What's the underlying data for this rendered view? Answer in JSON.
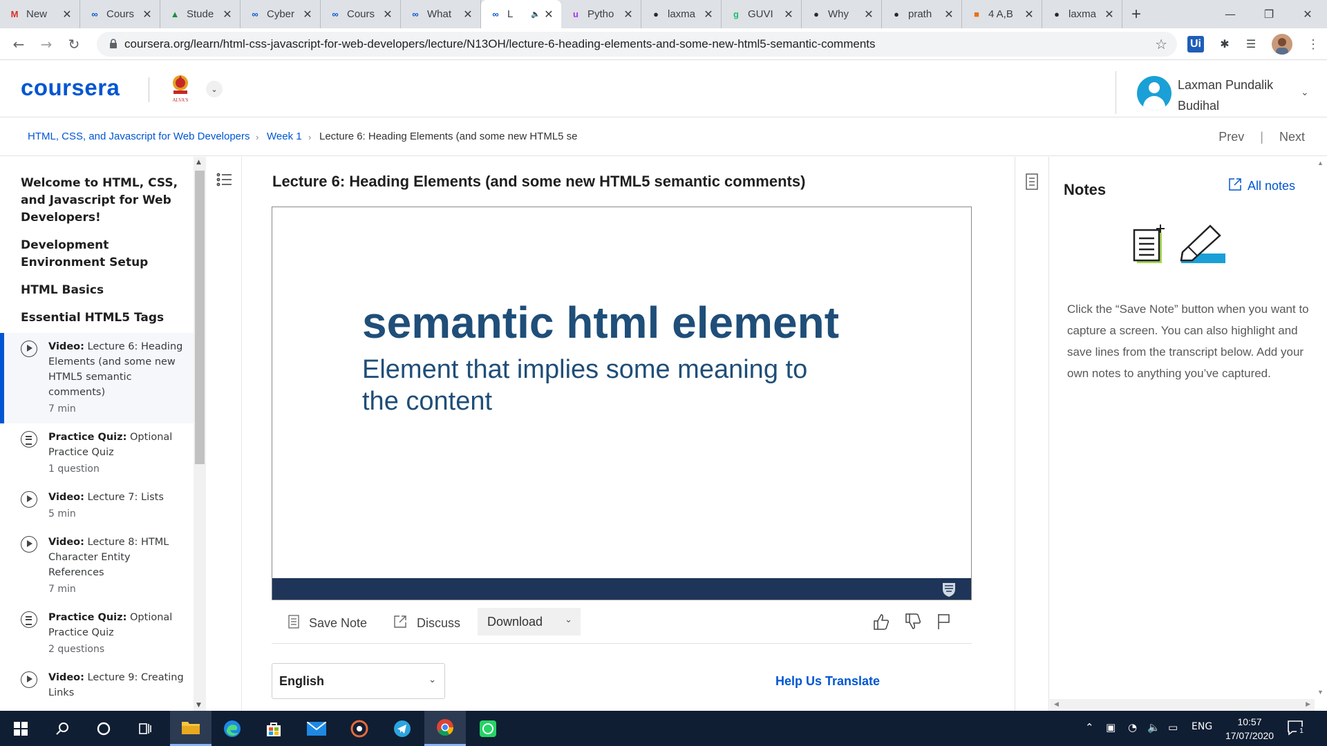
{
  "browser": {
    "tabs": [
      {
        "title": "New",
        "icon": "gmail-icon",
        "color": "#d93025",
        "glyph": "M"
      },
      {
        "title": "Cours",
        "icon": "coursera-icon",
        "color": "#0056d2",
        "glyph": "∞"
      },
      {
        "title": "Stude",
        "icon": "drive-icon",
        "color": "#1e8e3e",
        "glyph": "▲"
      },
      {
        "title": "Cyber",
        "icon": "coursera-icon",
        "color": "#0056d2",
        "glyph": "∞"
      },
      {
        "title": "Cours",
        "icon": "coursera-icon",
        "color": "#0056d2",
        "glyph": "∞"
      },
      {
        "title": "What",
        "icon": "coursera-icon",
        "color": "#0056d2",
        "glyph": "∞"
      },
      {
        "title": "L",
        "icon": "coursera-icon",
        "color": "#0056d2",
        "glyph": "∞",
        "active": true,
        "audio": "🔈"
      },
      {
        "title": "Pytho",
        "icon": "udemy-icon",
        "color": "#a435f0",
        "glyph": "u"
      },
      {
        "title": "laxma",
        "icon": "github-icon",
        "color": "#24292e",
        "glyph": "●"
      },
      {
        "title": "GUVI",
        "icon": "guvi-icon",
        "color": "#1dbf73",
        "glyph": "g"
      },
      {
        "title": "Why",
        "icon": "github-icon",
        "color": "#24292e",
        "glyph": "●"
      },
      {
        "title": "prath",
        "icon": "github-icon",
        "color": "#24292e",
        "glyph": "●"
      },
      {
        "title": "4 A,B",
        "icon": "orange-site-icon",
        "color": "#e8710a",
        "glyph": "■"
      },
      {
        "title": "laxma",
        "icon": "github-icon",
        "color": "#24292e",
        "glyph": "●"
      }
    ],
    "close_glyph": "✕",
    "new_tab_glyph": "+",
    "minimize_glyph": "—",
    "maximize_glyph": "❐",
    "close_window_glyph": "✕",
    "back_glyph": "←",
    "forward_glyph": "→",
    "reload_glyph": "↻",
    "url": "coursera.org/learn/html-css-javascript-for-web-developers/lecture/N13OH/lecture-6-heading-elements-and-some-new-html5-semantic-comments",
    "bookmark_glyph": "☆",
    "ext_uipath_label": "Ui",
    "ext_puzzle_glyph": "✱",
    "ext_media_glyph": "☰"
  },
  "header": {
    "logo_text": "coursera",
    "institution_logo_text": "ALVA'S",
    "user_name": "Laxman Pundalik Budihal",
    "caret": "⌄"
  },
  "breadcrumb": {
    "course": "HTML, CSS, and Javascript for Web Developers",
    "week": "Week 1",
    "current": "Lecture 6: Heading Elements (and some new HTML5 se",
    "separator": "›",
    "prev": "Prev",
    "next": "Next",
    "divider": "|"
  },
  "sidebar": {
    "sections": [
      "Welcome to HTML, CSS, and Javascript for Web Developers!",
      "Development Environment Setup",
      "HTML Basics",
      "Essential HTML5 Tags"
    ],
    "items": [
      {
        "kind": "Video:",
        "title": "Lecture 6: Heading Elements (and some new HTML5 semantic comments)",
        "meta": "7 min",
        "type": "video",
        "active": true
      },
      {
        "kind": "Practice Quiz:",
        "title": "Optional Practice Quiz",
        "meta": "1 question",
        "type": "quiz"
      },
      {
        "kind": "Video:",
        "title": "Lecture 7: Lists",
        "meta": "5 min",
        "type": "video"
      },
      {
        "kind": "Video:",
        "title": "Lecture 8: HTML Character Entity References",
        "meta": "7 min",
        "type": "video"
      },
      {
        "kind": "Practice Quiz:",
        "title": "Optional Practice Quiz",
        "meta": "2 questions",
        "type": "quiz"
      },
      {
        "kind": "Video:",
        "title": "Lecture 9: Creating Links",
        "meta": "",
        "type": "video"
      }
    ]
  },
  "lecture": {
    "title": "Lecture 6: Heading Elements (and some new HTML5 semantic comments)",
    "slide_heading": "semantic html element",
    "slide_subheading": "Element that implies some meaning to the content",
    "actions": {
      "save_note": "Save Note",
      "discuss": "Discuss",
      "download": "Download"
    },
    "language": "English",
    "help_translate": "Help Us Translate"
  },
  "notes": {
    "title": "Notes",
    "all_notes": "All notes",
    "description": "Click the “Save Note” button when you want to capture a screen. You can also highlight and save lines from the transcript below. Add your own notes to anything you’ve captured."
  },
  "taskbar": {
    "items": [
      "start-icon",
      "search-icon",
      "cortana-icon",
      "task-view-icon",
      "file-explorer-icon",
      "edge-icon",
      "store-icon",
      "mail-icon",
      "media-player-icon",
      "telegram-icon",
      "chrome-icon",
      "whatsapp-icon"
    ],
    "language": "ENG",
    "time": "10:57",
    "date": "17/07/2020",
    "notification_count": "1"
  },
  "colors": {
    "brand": "#0056d2",
    "slide_text": "#1f4e79",
    "slide_bar": "#1e3559",
    "taskbar": "#101e33"
  }
}
